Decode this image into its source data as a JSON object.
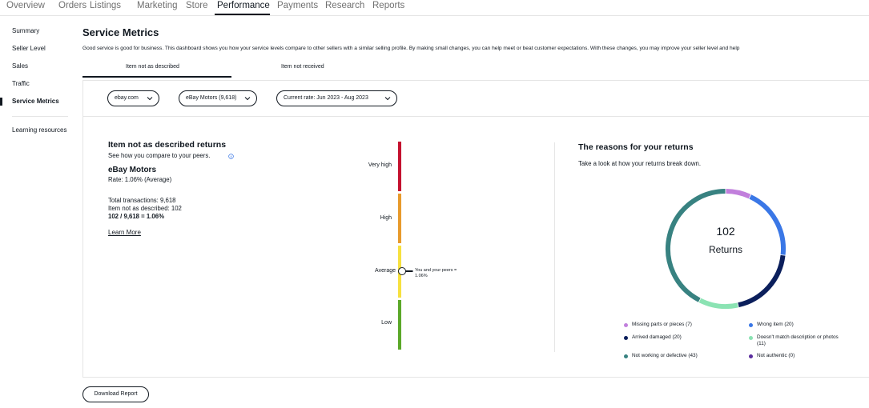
{
  "topnav": {
    "tabs": [
      "Overview",
      "Orders",
      "Listings",
      "Marketing",
      "Store",
      "Performance",
      "Payments",
      "Research",
      "Reports"
    ],
    "active": "Performance"
  },
  "sidebar": {
    "items": [
      "Summary",
      "Seller Level",
      "Sales",
      "Traffic",
      "Service Metrics",
      "Learning resources"
    ],
    "active": "Service Metrics"
  },
  "header": {
    "title": "Service Metrics",
    "intro": "Good service is good for business. This dashboard shows you how your service levels compare to other sellers with a similar selling profile. By making small changes, you can help meet or beat customer expectations. With these changes, you may improve your seller level and help"
  },
  "subtabs": [
    "Item not as described",
    "Item not received"
  ],
  "filters": {
    "site": "ebay.com",
    "category": "eBay Motors (9,618)",
    "rate": "Current rate: Jun 2023 - Aug 2023"
  },
  "summary": {
    "title": "Item not as described returns",
    "subtitle": "See how you compare to your peers.",
    "seller": "eBay Motors",
    "rate": "Rate: 1.06% (Average)",
    "total": "Total transactions: 9,618",
    "inad": "Item not as described: 102",
    "calc": "102 / 9,618 = 1.06%",
    "learn_more": "Learn More"
  },
  "gauge": {
    "levels": [
      "Very high",
      "High",
      "Average",
      "Low"
    ],
    "colors": [
      "#c4122f",
      "#e89a2c",
      "#f7e13f",
      "#5ba829"
    ],
    "marker_level": "Average",
    "marker_line1": "You and your peers =",
    "marker_line2": "1.06%"
  },
  "reasons": {
    "title": "The reasons for your returns",
    "subtitle": "Take a look at how your returns break down.",
    "total": "102",
    "total_label": "Returns",
    "legend": [
      {
        "label": "Missing parts or pieces (7)",
        "value": 7,
        "color": "#c17fdc"
      },
      {
        "label": "Wrong item (20)",
        "value": 20,
        "color": "#3a77e6"
      },
      {
        "label": "Arrived damaged (20)",
        "value": 20,
        "color": "#0b1f5c"
      },
      {
        "label": "Doesn't match description or photos",
        "label2": "(11)",
        "value": 11,
        "color": "#8be3b3"
      },
      {
        "label": "Not working or defective (43)",
        "value": 43,
        "color": "#388281"
      },
      {
        "label": "Not authentic (0)",
        "value": 0,
        "color": "#5b2e9e"
      }
    ]
  },
  "download_label": "Download Report"
}
